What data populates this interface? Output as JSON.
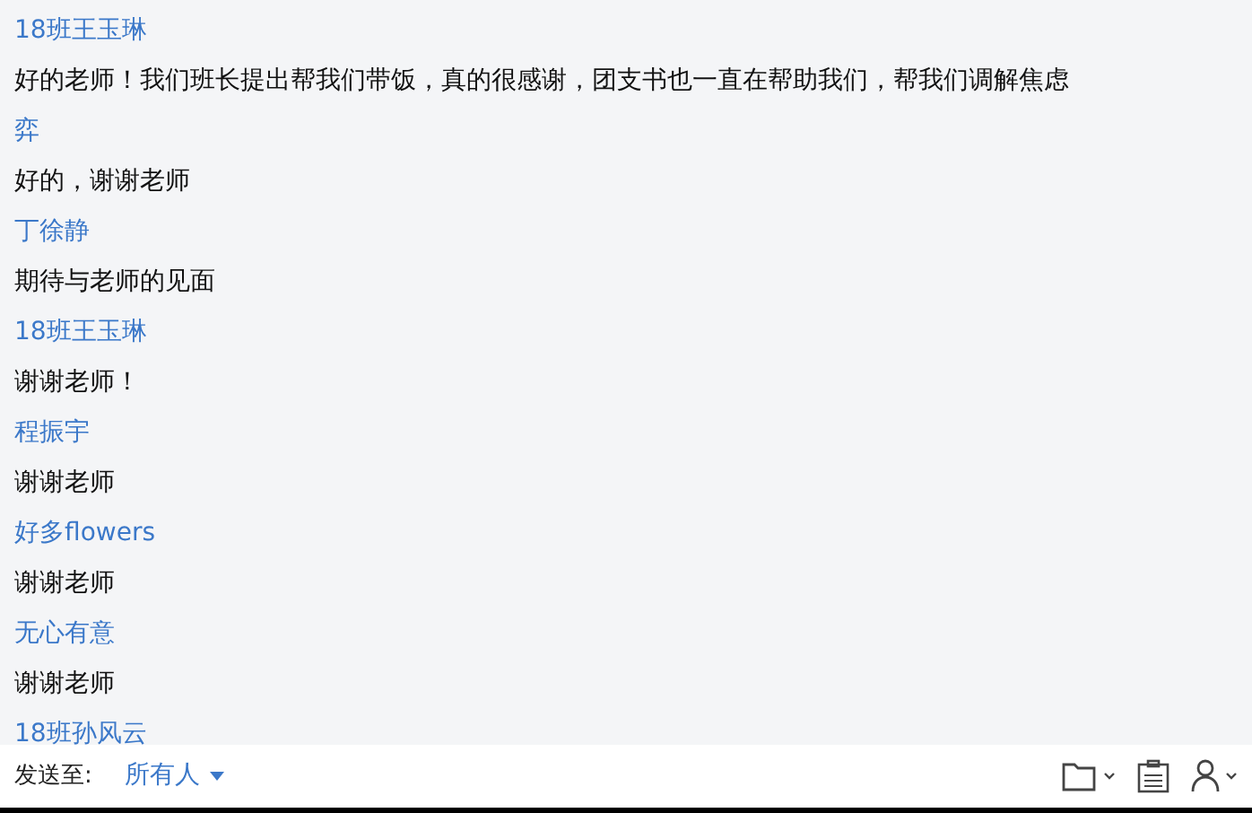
{
  "messages": [
    {
      "sender": "18班王玉琳",
      "text": "好的老师！我们班长提出帮我们带饭，真的很感谢，团支书也一直在帮助我们，帮我们调解焦虑"
    },
    {
      "sender": "弈",
      "text": "好的，谢谢老师"
    },
    {
      "sender": "丁徐静",
      "text": "期待与老师的见面"
    },
    {
      "sender": "18班王玉琳",
      "text": "谢谢老师！"
    },
    {
      "sender": "程振宇",
      "text": "谢谢老师"
    },
    {
      "sender": "好多flowers",
      "text": "谢谢老师"
    },
    {
      "sender": "无心有意",
      "text": "谢谢老师"
    },
    {
      "sender": "18班孙风云"
    }
  ],
  "send_bar": {
    "label": "发送至:",
    "recipient": "所有人"
  }
}
